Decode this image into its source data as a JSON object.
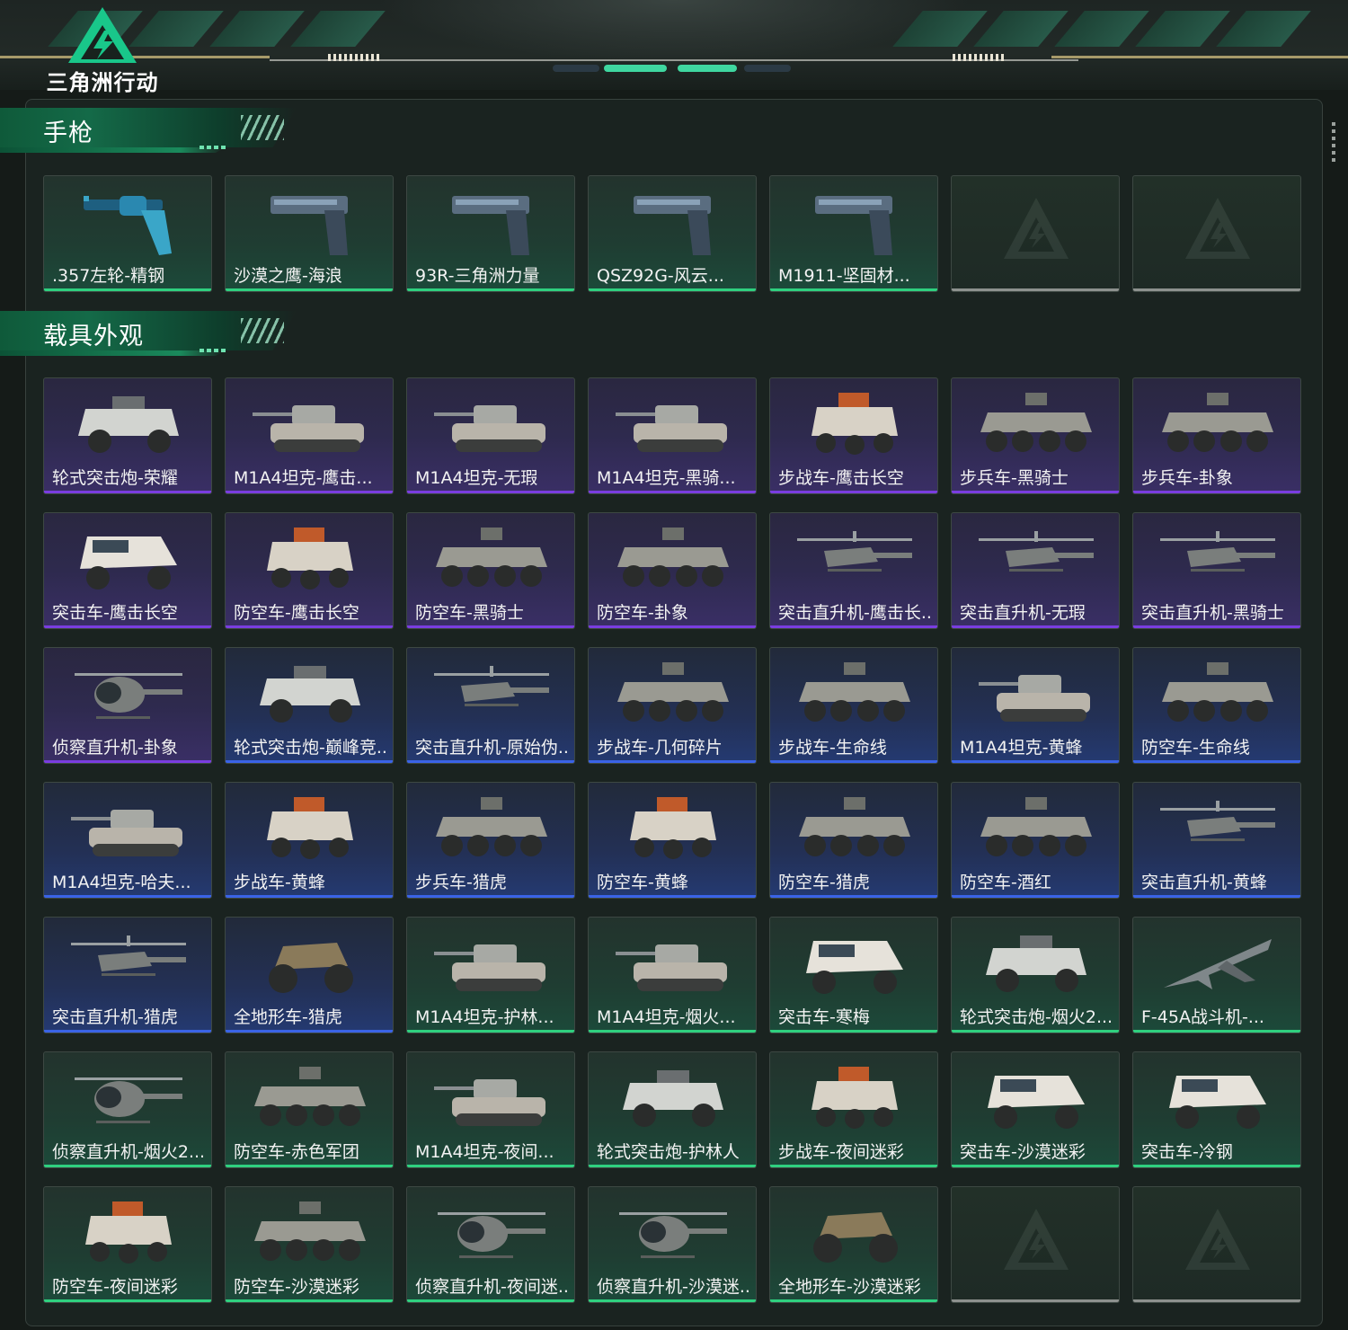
{
  "app": {
    "logo_text": "三角洲行动"
  },
  "colors": {
    "accent_green": "#2fd07f",
    "rarity_purple": "#7a3de0",
    "rarity_blue": "#3a63e6",
    "empty_gray": "#8d918e"
  },
  "sections": [
    {
      "title": "手枪",
      "items": [
        {
          "label": ".357左轮-精钢",
          "rarity": "green",
          "icon": "revolver-icon"
        },
        {
          "label": "沙漠之鹰-海浪",
          "rarity": "green",
          "icon": "pistol-icon"
        },
        {
          "label": "93R-三角洲力量",
          "rarity": "green",
          "icon": "pistol-icon"
        },
        {
          "label": "QSZ92G-风云...",
          "rarity": "green",
          "icon": "pistol-icon"
        },
        {
          "label": "M1911-坚固材...",
          "rarity": "green",
          "icon": "pistol-icon"
        },
        {
          "label": "",
          "rarity": "empty",
          "icon": "empty-slot-icon"
        },
        {
          "label": "",
          "rarity": "empty",
          "icon": "empty-slot-icon"
        }
      ]
    },
    {
      "title": "载具外观",
      "items": [
        {
          "label": "轮式突击炮-荣耀",
          "rarity": "purple",
          "icon": "armored-car-icon"
        },
        {
          "label": "M1A4坦克-鹰击...",
          "rarity": "purple",
          "icon": "tank-icon"
        },
        {
          "label": "M1A4坦克-无瑕",
          "rarity": "purple",
          "icon": "tank-icon"
        },
        {
          "label": "M1A4坦克-黑骑...",
          "rarity": "purple",
          "icon": "tank-icon"
        },
        {
          "label": "步战车-鹰击长空",
          "rarity": "purple",
          "icon": "ifv-icon"
        },
        {
          "label": "步兵车-黑骑士",
          "rarity": "purple",
          "icon": "apc-icon"
        },
        {
          "label": "步兵车-卦象",
          "rarity": "purple",
          "icon": "apc-icon"
        },
        {
          "label": "突击车-鹰击长空",
          "rarity": "purple",
          "icon": "assault-vehicle-icon"
        },
        {
          "label": "防空车-鹰击长空",
          "rarity": "purple",
          "icon": "ifv-icon"
        },
        {
          "label": "防空车-黑骑士",
          "rarity": "purple",
          "icon": "apc-icon"
        },
        {
          "label": "防空车-卦象",
          "rarity": "purple",
          "icon": "apc-icon"
        },
        {
          "label": "突击直升机-鹰击长...",
          "rarity": "purple",
          "icon": "helicopter-icon"
        },
        {
          "label": "突击直升机-无瑕",
          "rarity": "purple",
          "icon": "helicopter-icon"
        },
        {
          "label": "突击直升机-黑骑士",
          "rarity": "purple",
          "icon": "helicopter-icon"
        },
        {
          "label": "侦察直升机-卦象",
          "rarity": "purple",
          "icon": "scout-helicopter-icon"
        },
        {
          "label": "轮式突击炮-巅峰竞...",
          "rarity": "blue",
          "icon": "armored-car-icon"
        },
        {
          "label": "突击直升机-原始伪...",
          "rarity": "blue",
          "icon": "helicopter-icon"
        },
        {
          "label": "步战车-几何碎片",
          "rarity": "blue",
          "icon": "apc-icon"
        },
        {
          "label": "步战车-生命线",
          "rarity": "blue",
          "icon": "apc-icon"
        },
        {
          "label": "M1A4坦克-黄蜂",
          "rarity": "blue",
          "icon": "tank-icon"
        },
        {
          "label": "防空车-生命线",
          "rarity": "blue",
          "icon": "apc-icon"
        },
        {
          "label": "M1A4坦克-哈夫...",
          "rarity": "blue",
          "icon": "tank-icon"
        },
        {
          "label": "步战车-黄蜂",
          "rarity": "blue",
          "icon": "ifv-icon"
        },
        {
          "label": "步兵车-猎虎",
          "rarity": "blue",
          "icon": "apc-icon"
        },
        {
          "label": "防空车-黄蜂",
          "rarity": "blue",
          "icon": "ifv-icon"
        },
        {
          "label": "防空车-猎虎",
          "rarity": "blue",
          "icon": "apc-icon"
        },
        {
          "label": "防空车-酒红",
          "rarity": "blue",
          "icon": "apc-icon"
        },
        {
          "label": "突击直升机-黄蜂",
          "rarity": "blue",
          "icon": "helicopter-icon"
        },
        {
          "label": "突击直升机-猎虎",
          "rarity": "blue",
          "icon": "helicopter-icon"
        },
        {
          "label": "全地形车-猎虎",
          "rarity": "blue",
          "icon": "atv-icon"
        },
        {
          "label": "M1A4坦克-护林...",
          "rarity": "green",
          "icon": "tank-icon"
        },
        {
          "label": "M1A4坦克-烟火...",
          "rarity": "green",
          "icon": "tank-icon"
        },
        {
          "label": "突击车-寒梅",
          "rarity": "green",
          "icon": "assault-vehicle-icon"
        },
        {
          "label": "轮式突击炮-烟火2...",
          "rarity": "green",
          "icon": "armored-car-icon"
        },
        {
          "label": "F-45A战斗机-...",
          "rarity": "green",
          "icon": "fighter-jet-icon"
        },
        {
          "label": "侦察直升机-烟火2...",
          "rarity": "green",
          "icon": "scout-helicopter-icon"
        },
        {
          "label": "防空车-赤色军团",
          "rarity": "green",
          "icon": "apc-icon"
        },
        {
          "label": "M1A4坦克-夜间...",
          "rarity": "green",
          "icon": "tank-icon"
        },
        {
          "label": "轮式突击炮-护林人",
          "rarity": "green",
          "icon": "armored-car-icon"
        },
        {
          "label": "步战车-夜间迷彩",
          "rarity": "green",
          "icon": "ifv-icon"
        },
        {
          "label": "突击车-沙漠迷彩",
          "rarity": "green",
          "icon": "assault-vehicle-icon"
        },
        {
          "label": "突击车-冷钢",
          "rarity": "green",
          "icon": "assault-vehicle-icon"
        },
        {
          "label": "防空车-夜间迷彩",
          "rarity": "green",
          "icon": "ifv-icon"
        },
        {
          "label": "防空车-沙漠迷彩",
          "rarity": "green",
          "icon": "apc-icon"
        },
        {
          "label": "侦察直升机-夜间迷...",
          "rarity": "green",
          "icon": "scout-helicopter-icon"
        },
        {
          "label": "侦察直升机-沙漠迷...",
          "rarity": "green",
          "icon": "scout-helicopter-icon"
        },
        {
          "label": "全地形车-沙漠迷彩",
          "rarity": "green",
          "icon": "atv-icon"
        },
        {
          "label": "",
          "rarity": "empty",
          "icon": "empty-slot-icon"
        },
        {
          "label": "",
          "rarity": "empty",
          "icon": "empty-slot-icon"
        }
      ]
    }
  ]
}
